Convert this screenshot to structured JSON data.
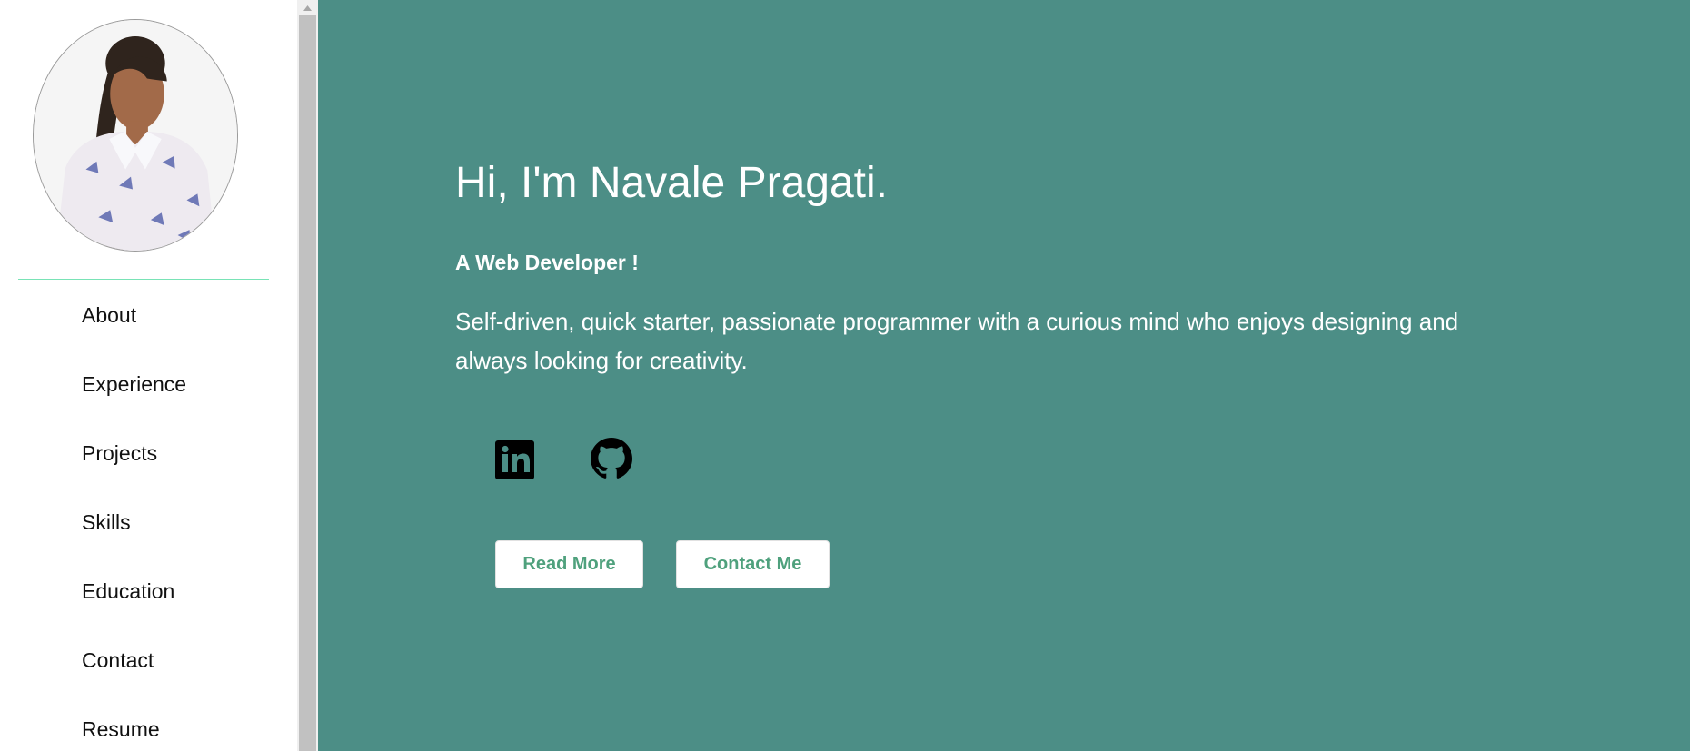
{
  "sidebar": {
    "avatar_icon": "profile-photo",
    "divider_color": "#79e3b6",
    "nav_items": [
      {
        "label": "About"
      },
      {
        "label": "Experience"
      },
      {
        "label": "Projects"
      },
      {
        "label": "Skills"
      },
      {
        "label": "Education"
      },
      {
        "label": "Contact"
      },
      {
        "label": "Resume"
      }
    ]
  },
  "hero": {
    "title": "Hi, I'm Navale Pragati.",
    "subtitle": "A Web Developer !",
    "description": "Self-driven, quick starter, passionate programmer with a curious mind who enjoys designing and always looking for creativity.",
    "background_color": "#4c8e86",
    "social_icons": [
      "linkedin-icon",
      "github-icon"
    ],
    "buttons": {
      "read_more": "Read More",
      "contact_me": "Contact Me"
    },
    "button_text_color": "#4fa17d"
  }
}
